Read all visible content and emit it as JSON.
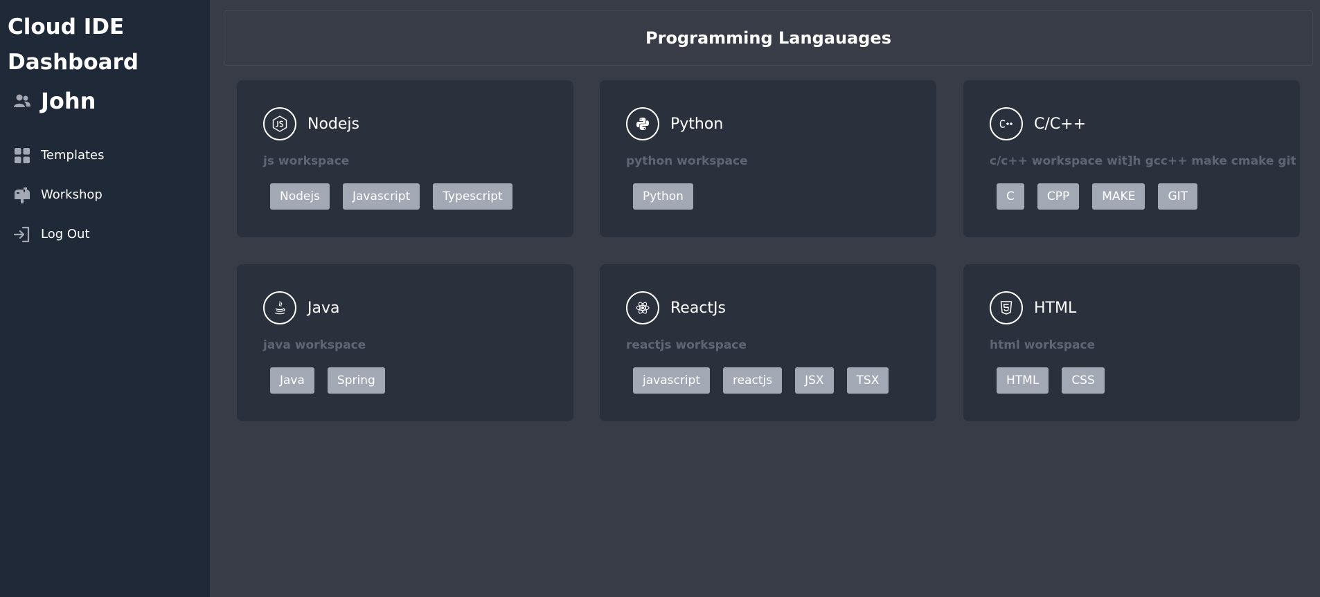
{
  "sidebar": {
    "title": "Cloud IDE Dashboard",
    "user_name": "John",
    "items": [
      {
        "label": "Templates",
        "icon": "grid-icon"
      },
      {
        "label": "Workshop",
        "icon": "mailbox-icon"
      },
      {
        "label": "Log Out",
        "icon": "logout-icon"
      }
    ]
  },
  "header": {
    "title": "Programming Langauages"
  },
  "cards": [
    {
      "title": "Nodejs",
      "desc": "js workspace",
      "icon": "nodejs-icon",
      "tags": [
        "Nodejs",
        "Javascript",
        "Typescript"
      ]
    },
    {
      "title": "Python",
      "desc": "python workspace",
      "icon": "python-icon",
      "tags": [
        "Python"
      ]
    },
    {
      "title": "C/C++",
      "desc": "c/c++ workspace wit]h gcc++ make cmake git",
      "icon": "cpp-icon",
      "tags": [
        "C",
        "CPP",
        "MAKE",
        "GIT"
      ]
    },
    {
      "title": "Java",
      "desc": "java workspace",
      "icon": "java-icon",
      "tags": [
        "Java",
        "Spring"
      ]
    },
    {
      "title": "ReactJs",
      "desc": "reactjs workspace",
      "icon": "react-icon",
      "tags": [
        "javascript",
        "reactjs",
        "JSX",
        "TSX"
      ]
    },
    {
      "title": "HTML",
      "desc": "html workspace",
      "icon": "html5-icon",
      "tags": [
        "HTML",
        "CSS"
      ]
    }
  ],
  "colors": {
    "sidebar_bg": "#1f2937",
    "main_bg": "#383c46",
    "card_bg": "#2a303c",
    "tag_bg": "#a3a9b4",
    "muted_text": "#5f6673"
  }
}
